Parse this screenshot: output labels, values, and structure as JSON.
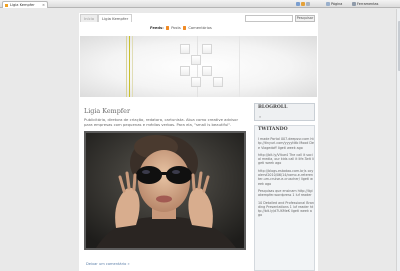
{
  "browser": {
    "tab_title": "Ligia Kempfer",
    "tab_close": "×",
    "pagina_label": "Página",
    "ferramentas_label": "Ferramentas"
  },
  "nav": {
    "home": "Início",
    "active": "Ligia Kempfer",
    "search_button": "Pesquisar"
  },
  "feeds": {
    "label": "Feeds:",
    "posts": "Posts",
    "comments": "Comentários"
  },
  "post": {
    "title": "Ligia Kempfer",
    "text": "Publicitária, diretora de criação, redatora, cartunista. Atua como creative advisor para empresas com pequenas e médias verbas. Para ela, \"small is beautiful\".",
    "comments_link": "Deixar um comentário »"
  },
  "sidebar": {
    "blogroll_title": "BLOGROLL",
    "blogroll_bullet": "»",
    "twitter_title": "TWITANDO",
    "tweets": [
      "I made Portal 007.deepsvr.com http://tinyurl.com/yyyytttb Mood Dee Viagedoff ligeti week ago",
      "http://bit.ly/Vltue4 The call it social media, our kids call it life.Twit ligeti week ago",
      "http://blogs.estadao.com.br/s ocyalerst2010/06/14/como-e-reterenter-um-cruise-e-cruscher/ ligeti week ago",
      "Pesquisas que ensinam http://ligiakempfer.wordpress 1 luf reader",
      "10 Detailed and Professional Branding Presentations 1 luf reader http://bit.ly/d7UXMeK ligeti week ago"
    ]
  },
  "colors": {
    "banner_accent": "#c9c02a",
    "page_bg": "#e9e9e9",
    "link": "#5a7ea8"
  },
  "icons": [
    "tab-favicon",
    "home-icon",
    "page-icon",
    "tools-icon",
    "rss-icon",
    "close-icon"
  ]
}
